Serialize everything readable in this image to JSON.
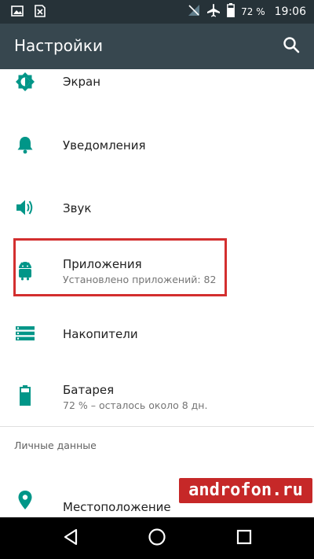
{
  "statusbar": {
    "battery_percent": "72 %",
    "time": "19:06",
    "icons": [
      "image-icon",
      "sim-blocked-icon",
      "no-sim-icon",
      "airplane-icon",
      "battery-icon"
    ]
  },
  "toolbar": {
    "title": "Настройки",
    "search_icon": "search-icon"
  },
  "items": [
    {
      "label": "Экран",
      "icon": "brightness-icon"
    },
    {
      "label": "Уведомления",
      "icon": "bell-icon"
    },
    {
      "label": "Звук",
      "icon": "volume-icon"
    },
    {
      "label": "Приложения",
      "subtitle": "Установлено приложений: 82",
      "icon": "android-icon"
    },
    {
      "label": "Накопители",
      "icon": "storage-icon"
    },
    {
      "label": "Батарея",
      "subtitle": "72 % – осталось около 8 дн.",
      "icon": "battery-icon"
    },
    {
      "label": "Местоположение",
      "icon": "location-icon"
    }
  ],
  "section": {
    "personal_header": "Личные данные"
  },
  "watermark": "androfon.ru",
  "colors": {
    "accent": "#009688",
    "statusbar": "#263238",
    "toolbar": "#37474f",
    "highlight": "#d32f2f"
  }
}
